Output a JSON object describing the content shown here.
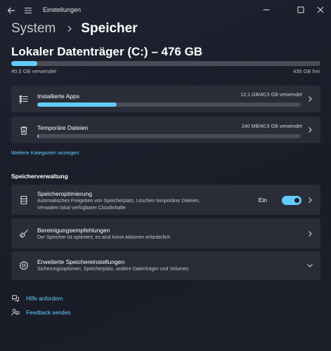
{
  "window": {
    "title": "Einstellungen"
  },
  "breadcrumb": {
    "parent": "System",
    "current": "Speicher"
  },
  "drive": {
    "title": "Lokaler Datenträger (C:) – 476 GB",
    "used_label": "40,5 GB verwendet",
    "free_label": "435 GB frei",
    "used_fraction": 0.085
  },
  "categories": [
    {
      "title": "Installierte Apps",
      "usage": "12,1 GB/40,5 GB verwendet",
      "fraction": 0.3,
      "icon": "list-icon"
    },
    {
      "title": "Temporäre Dateien",
      "usage": "240 MB/40,5 GB verwendet",
      "fraction": 0.006,
      "icon": "trash-icon"
    }
  ],
  "more_categories_label": "Weitere Kategorien anzeigen",
  "management": {
    "section_title": "Speicherverwaltung",
    "items": [
      {
        "title": "Speicheroptimierung",
        "subtitle_line1": "Automatisches Freigeben von Speicherplatz, Löschen temporärer Dateien,",
        "subtitle_line2": "Verwalten lokal verfügbarer Cloudinhalte",
        "toggle_label": "Ein",
        "toggle_on": true,
        "icon": "storage-icon"
      },
      {
        "title": "Bereinigungsempfehlungen",
        "subtitle_line1": "Der Speicher ist optimiert, es sind keine Aktionen erforderlich",
        "icon": "broom-icon"
      },
      {
        "title": "Erweiterte Speichereinstellungen",
        "subtitle_line1": "Sicherungsoptionen, Speicherplatz, andere Datenträger und Volumes",
        "icon": "gear-icon"
      }
    ]
  },
  "footer": {
    "help_label": "Hilfe anfordern",
    "feedback_label": "Feedback senden"
  },
  "colors": {
    "accent": "#60cdff",
    "card": "#2a2d38",
    "background": "#1c1f2a",
    "track": "#4a4d57"
  }
}
